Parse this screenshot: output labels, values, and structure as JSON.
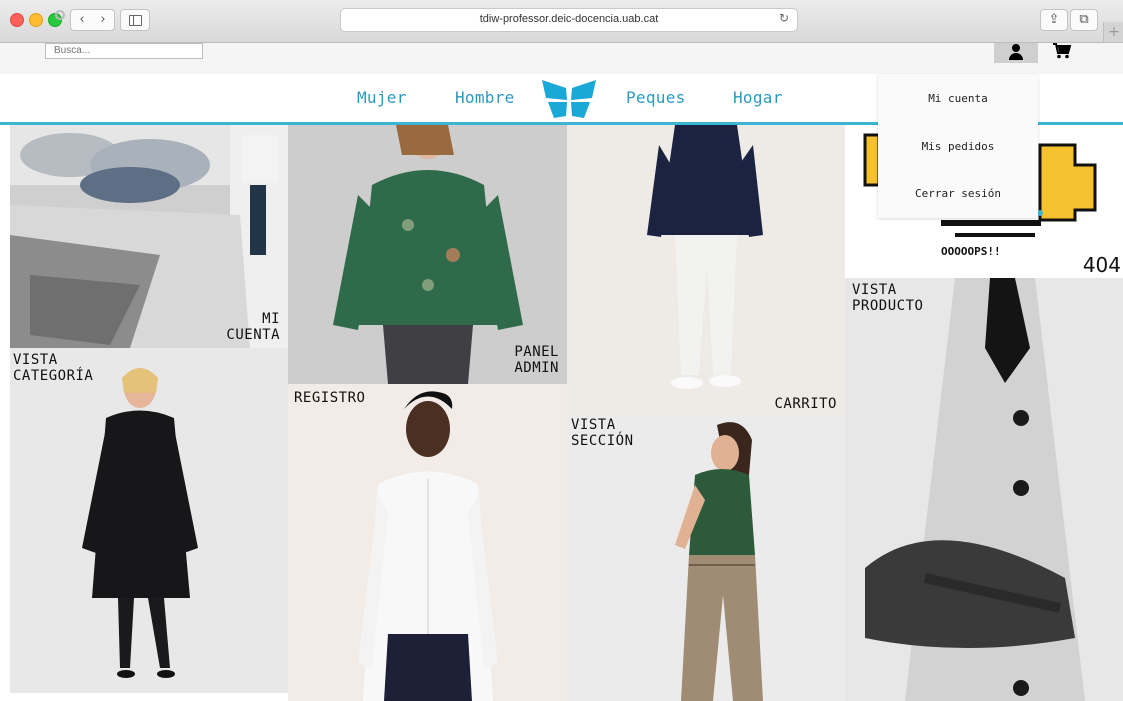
{
  "browser": {
    "url": "tdiw-professor.deic-docencia.uab.cat",
    "back_glyph": "‹",
    "forward_glyph": "›",
    "reload_glyph": "↻",
    "share_glyph": "⇪",
    "tabs_glyph": "⧉",
    "plus_glyph": "+"
  },
  "header": {
    "search_placeholder": "Busca...",
    "cart_glyph": "🛒"
  },
  "nav": {
    "items": [
      "Mujer",
      "Hombre",
      "Peques",
      "Hogar"
    ]
  },
  "account_menu": {
    "items": [
      "Mi cuenta",
      "Mis pedidos",
      "Cerrar sesión"
    ]
  },
  "tiles": {
    "mi_cuenta": [
      "MI",
      "CUENTA"
    ],
    "panel_admin": [
      "PANEL",
      "ADMIN"
    ],
    "carrito": "CARRITO",
    "error_text": "OOOOOPS!!",
    "error_code": "404",
    "vista_producto": [
      "VISTA",
      "PRODUCTO"
    ],
    "vista_categoria": [
      "VISTA",
      "CATEGORÍA"
    ],
    "registro": "REGISTRO",
    "vista_seccion": [
      "VISTA",
      "SECCIÓN"
    ]
  },
  "colors": {
    "accent": "#3cb4d4",
    "nav_link": "#2a9bc0",
    "error_yellow": "#f5c12e"
  }
}
